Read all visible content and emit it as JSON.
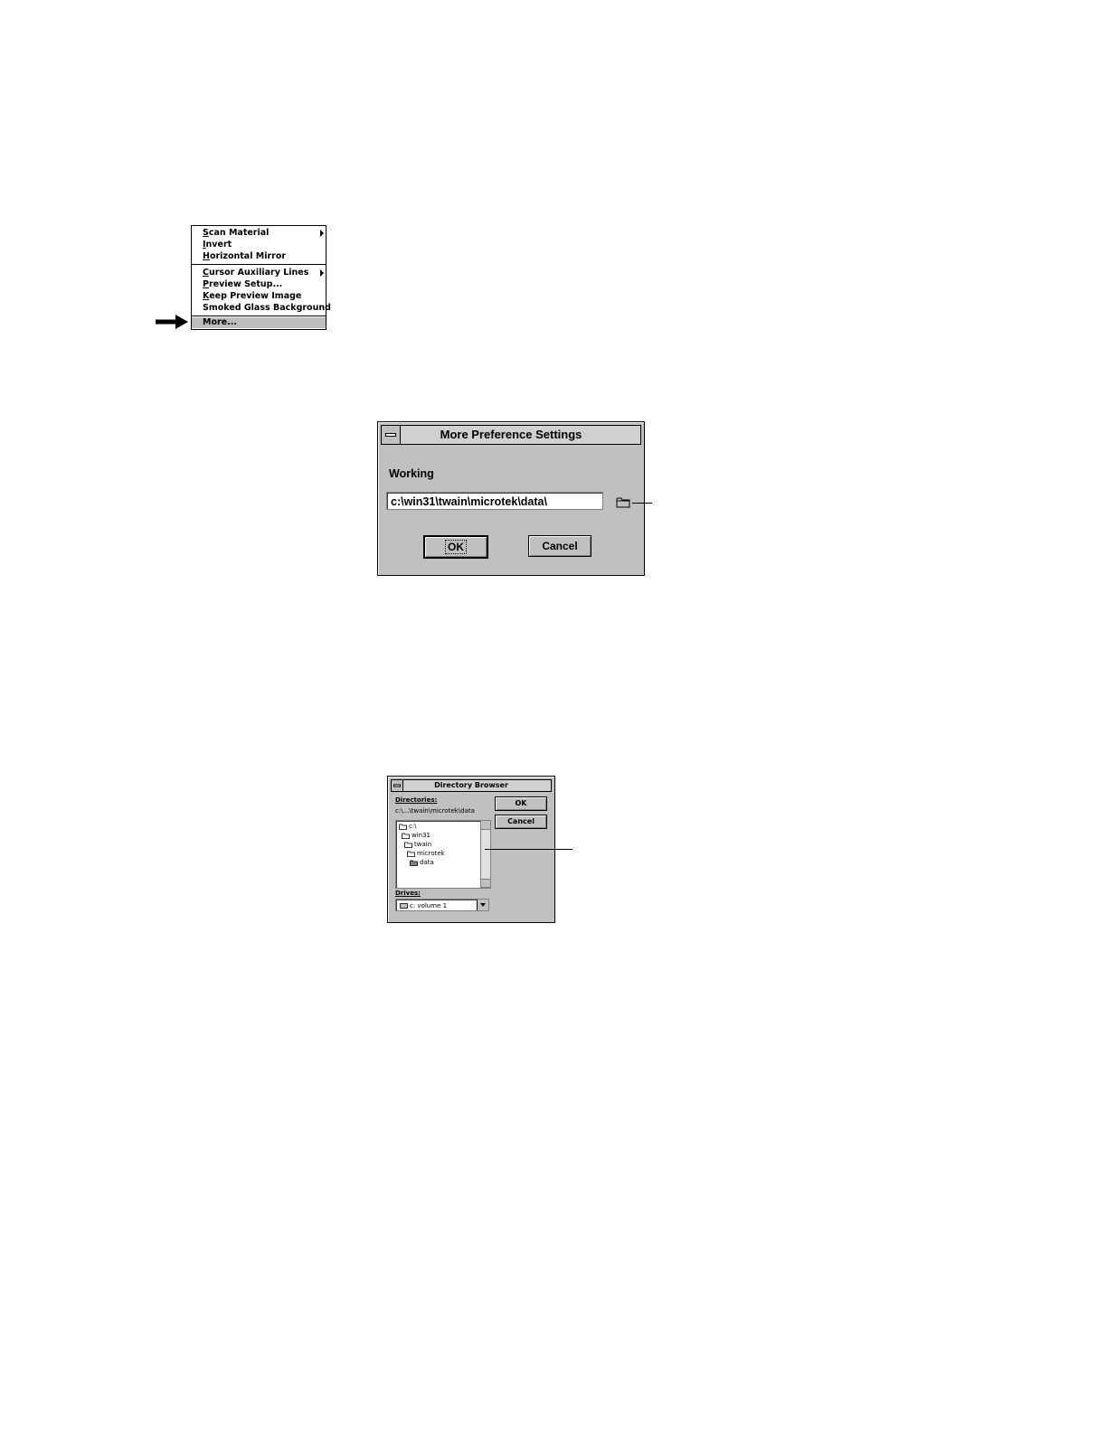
{
  "menu": {
    "items": [
      {
        "prefix": "S",
        "rest": "can Material"
      },
      {
        "prefix": "I",
        "rest": "nvert"
      },
      {
        "prefix": "H",
        "rest": "orizontal Mirror"
      },
      {
        "prefix": "C",
        "rest": "ursor Auxiliary Lines"
      },
      {
        "prefix": "P",
        "rest": "review Setup..."
      },
      {
        "prefix": "K",
        "rest": "eep Preview Image"
      },
      {
        "prefix": "",
        "rest": "Smoked Glass Background"
      },
      {
        "prefix": "",
        "rest": "More..."
      }
    ]
  },
  "dialog_preferences": {
    "title": "More Preference Settings",
    "working_label": "Working",
    "path_value": "c:\\win31\\twain\\microtek\\data\\",
    "ok_label": "OK",
    "cancel_label": "Cancel"
  },
  "dialog_directory": {
    "title": "Directory Browser",
    "directories_label": "Directories:",
    "current_path": "c:\\...\\twain\\microtek\\data",
    "tree": [
      "c:\\",
      "win31",
      "twain",
      "microtek",
      "data"
    ],
    "drives_label": "Drives:",
    "drive_value": "c: volume 1",
    "ok_label": "OK",
    "cancel_label": "Cancel"
  },
  "icons": [
    "arrow-right-icon",
    "submenu-arrow-icon",
    "folder-icon",
    "drive-icon",
    "scroll-up-icon",
    "scroll-down-icon",
    "dropdown-arrow-icon"
  ]
}
